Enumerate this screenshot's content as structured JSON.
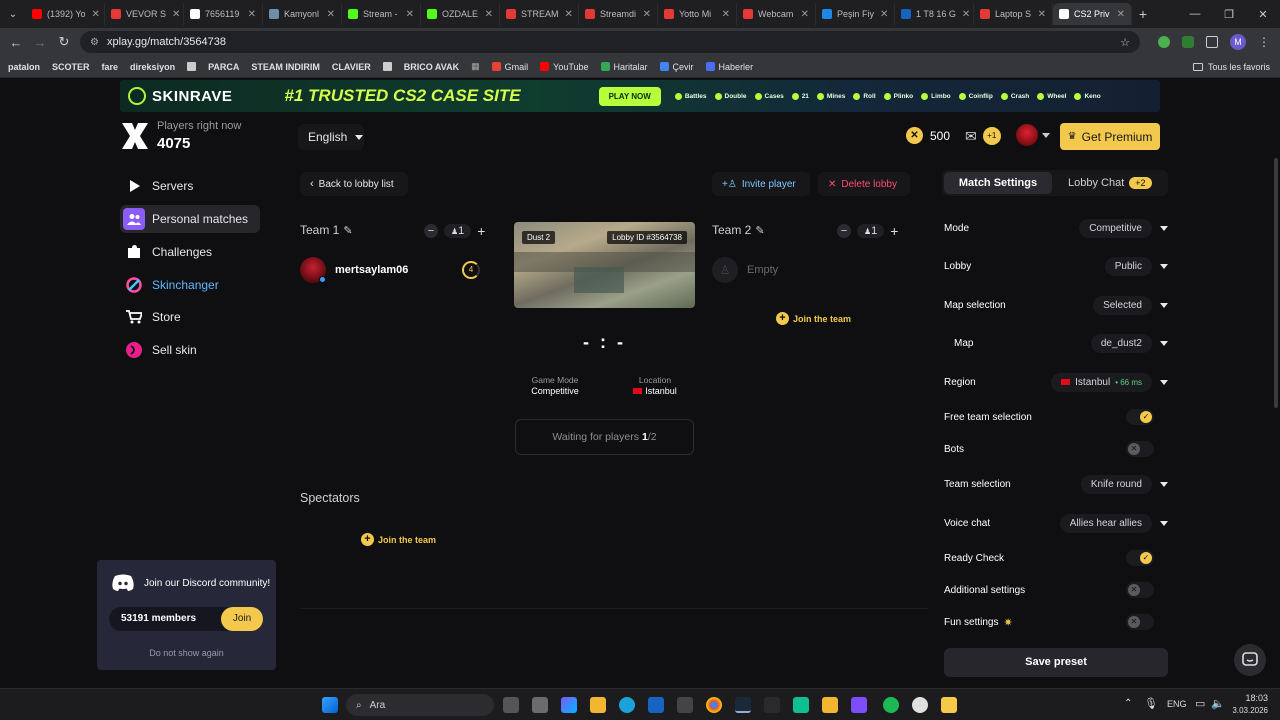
{
  "browser": {
    "tabs": [
      {
        "label": "(1392) Yo",
        "color": "#ff0000"
      },
      {
        "label": "VEVOR S",
        "color": "#e53935"
      },
      {
        "label": "7656119",
        "color": "#ffffff"
      },
      {
        "label": "Kamyonl",
        "color": "#6b8fa8"
      },
      {
        "label": "Stream -",
        "color": "#53fc18"
      },
      {
        "label": "OZDALE",
        "color": "#53fc18"
      },
      {
        "label": "STREAM",
        "color": "#e53935"
      },
      {
        "label": "Streamdi",
        "color": "#e53935"
      },
      {
        "label": "Yotto Mi",
        "color": "#e53935"
      },
      {
        "label": "Webcam",
        "color": "#e53935"
      },
      {
        "label": "Peşin Fiy",
        "color": "#1e88e5"
      },
      {
        "label": "1 T8 16 G",
        "color": "#1565c0"
      },
      {
        "label": "Laptop S",
        "color": "#e53935"
      },
      {
        "label": "CS2 Priv",
        "color": "#ffffff"
      }
    ],
    "url": "xplay.gg/match/3564738",
    "bookmarks": [
      "patalon",
      "SCOTER",
      "fare",
      "direksiyon",
      "",
      "PARCA",
      "STEAM INDIRIM",
      "CLAVIER",
      "",
      "BRICO AVAK"
    ],
    "bookmark_links": [
      "Gmail",
      "YouTube",
      "Haritalar",
      "Çevir",
      "Haberler"
    ],
    "all_bookmarks": "Tous les favoris"
  },
  "banner": {
    "brand": "SKINRAVE",
    "headline": "#1 TRUSTED CS2 CASE SITE",
    "cta": "PLAY NOW",
    "modes": [
      "Battles",
      "Double",
      "Cases",
      "21",
      "Mines",
      "Roll",
      "Plinko",
      "Limbo",
      "Coinflip",
      "Crash",
      "Wheel",
      "Keno"
    ]
  },
  "header": {
    "players_label": "Players right now",
    "players_count": "4075",
    "language": "English",
    "balance": "500",
    "mail_badge": "+1",
    "premium_label": "Get Premium"
  },
  "sidebar": {
    "items": [
      {
        "label": "Servers"
      },
      {
        "label": "Personal matches"
      },
      {
        "label": "Challenges"
      },
      {
        "label": "Skinchanger"
      },
      {
        "label": "Store"
      },
      {
        "label": "Sell skin"
      }
    ]
  },
  "discord": {
    "title": "Join our Discord community!",
    "members": "53191 members",
    "join": "Join",
    "dismiss": "Do not show again"
  },
  "lobby": {
    "back": "Back to lobby list",
    "invite": "Invite player",
    "delete": "Delete lobby",
    "team1": {
      "name": "Team 1",
      "count": "1",
      "player": "mertsaylam06",
      "level": "4"
    },
    "team2": {
      "name": "Team 2",
      "count": "1",
      "empty": "Empty",
      "join": "Join the team"
    },
    "map": {
      "name": "Dust 2",
      "lobby_id": "Lobby ID #3564738"
    },
    "score": "- : -",
    "game_mode_label": "Game Mode",
    "game_mode": "Competitive",
    "location_label": "Location",
    "location": "Istanbul",
    "waiting_prefix": "Waiting for players ",
    "waiting_current": "1",
    "waiting_total": "/2",
    "spectators": "Spectators",
    "spectators_join": "Join the team"
  },
  "settings": {
    "tab_match": "Match Settings",
    "tab_chat": "Lobby Chat",
    "chat_badge": "+2",
    "rows": {
      "mode": {
        "label": "Mode",
        "value": "Competitive"
      },
      "lobby": {
        "label": "Lobby",
        "value": "Public"
      },
      "map_selection": {
        "label": "Map selection",
        "value": "Selected"
      },
      "map": {
        "label": "Map",
        "value": "de_dust2"
      },
      "region": {
        "label": "Region",
        "value": "Istanbul",
        "ping": "• 66 ms"
      },
      "free_team": {
        "label": "Free team selection"
      },
      "bots": {
        "label": "Bots"
      },
      "team_selection": {
        "label": "Team selection",
        "value": "Knife round"
      },
      "voice_chat": {
        "label": "Voice chat",
        "value": "Allies hear allies"
      },
      "ready_check": {
        "label": "Ready Check"
      },
      "additional": {
        "label": "Additional settings"
      },
      "fun": {
        "label": "Fun settings"
      }
    },
    "save_preset": "Save preset"
  },
  "taskbar": {
    "search": "Ara",
    "lang": "ENG",
    "time": "18:03",
    "date": "3.03.2026"
  }
}
